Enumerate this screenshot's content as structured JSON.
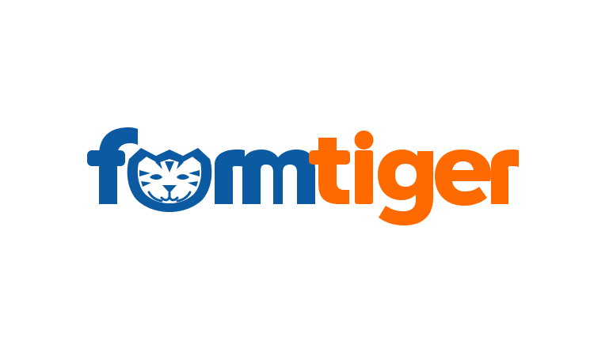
{
  "logo": {
    "wordmark": "formtiger",
    "part_primary": "form",
    "part_secondary": "tiger",
    "icon": "tiger-face-icon",
    "colors": {
      "primary": "#0b5aa2",
      "secondary": "#ff6a00",
      "background": "#ffffff"
    }
  }
}
